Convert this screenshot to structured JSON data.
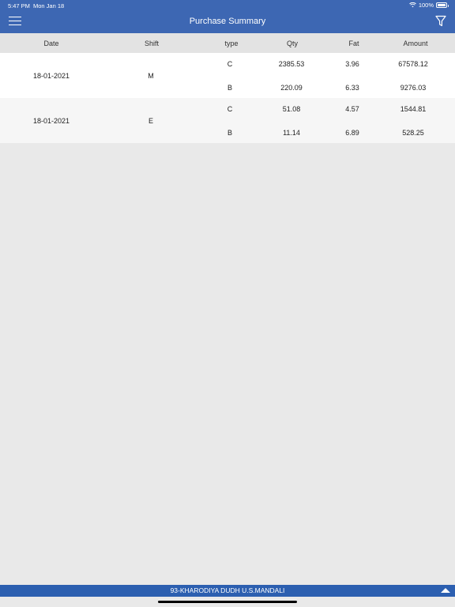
{
  "status_bar": {
    "time": "5:47 PM",
    "date": "Mon Jan 18",
    "battery": "100%"
  },
  "header": {
    "title": "Purchase Summary",
    "menu_icon": "hamburger-icon",
    "filter_icon": "filter-icon"
  },
  "table": {
    "columns": [
      "Date",
      "Shift",
      "type",
      "Qty",
      "Fat",
      "Amount"
    ],
    "groups": [
      {
        "date": "18-01-2021",
        "shift": "M",
        "rows": [
          {
            "type": "C",
            "qty": "2385.53",
            "fat": "3.96",
            "amount": "67578.12"
          },
          {
            "type": "B",
            "qty": "220.09",
            "fat": "6.33",
            "amount": "9276.03"
          }
        ]
      },
      {
        "date": "18-01-2021",
        "shift": "E",
        "rows": [
          {
            "type": "C",
            "qty": "51.08",
            "fat": "4.57",
            "amount": "1544.81"
          },
          {
            "type": "B",
            "qty": "11.14",
            "fat": "6.89",
            "amount": "528.25"
          }
        ]
      }
    ]
  },
  "footer": {
    "text": "93-KHARODIYA DUDH U.S.MANDALI",
    "arrow_icon": "chevron-up-icon"
  },
  "colors": {
    "primary": "#3d67b3",
    "footer": "#2c5fb0",
    "background": "#e9e9e9"
  }
}
